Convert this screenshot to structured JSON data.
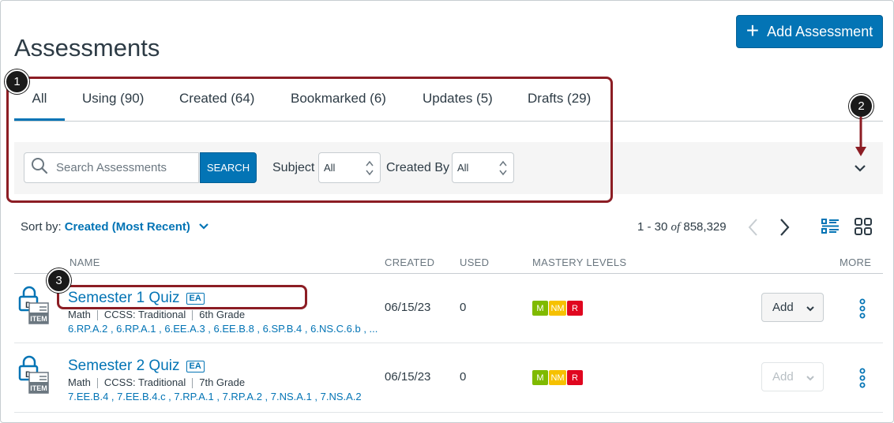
{
  "page": {
    "title": "Assessments",
    "add_button": "Add Assessment"
  },
  "tabs": [
    {
      "label": "All",
      "active": true
    },
    {
      "label": "Using (90)"
    },
    {
      "label": "Created (64)"
    },
    {
      "label": "Bookmarked (6)"
    },
    {
      "label": "Updates (5)"
    },
    {
      "label": "Drafts (29)"
    }
  ],
  "filters": {
    "search_placeholder": "Search Assessments",
    "search_button": "SEARCH",
    "subject_label": "Subject",
    "subject_value": "All",
    "created_by_label": "Created By",
    "created_by_value": "All"
  },
  "sort": {
    "label": "Sort by:",
    "value": "Created (Most Recent)"
  },
  "pagination": {
    "range": "1 - 30",
    "of": "of",
    "total": "858,329"
  },
  "columns": {
    "name": "NAME",
    "created": "CREATED",
    "used": "USED",
    "mastery": "MASTERY LEVELS",
    "more": "MORE"
  },
  "rows": [
    {
      "title": "Semester 1 Quiz",
      "badge": "EA",
      "subject": "Math",
      "framework": "CCSS: Traditional",
      "grade": "6th Grade",
      "standards": "6.RP.A.2 , 6.RP.A.1 , 6.EE.A.3 , 6.EE.B.8 , 6.SP.B.4 , 6.NS.C.6.b , ...",
      "created": "06/15/23",
      "used": "0",
      "mastery": [
        "M",
        "NM",
        "R"
      ],
      "add_label": "Add",
      "add_disabled": false
    },
    {
      "title": "Semester 2 Quiz",
      "badge": "EA",
      "subject": "Math",
      "framework": "CCSS: Traditional",
      "grade": "7th Grade",
      "standards": "7.EE.B.4 , 7.EE.B.4.c , 7.RP.A.1 , 7.RP.A.2 , 7.NS.A.1 , 7.NS.A.2",
      "created": "06/15/23",
      "used": "0",
      "mastery": [
        "M",
        "NM",
        "R"
      ],
      "add_label": "Add",
      "add_disabled": true
    }
  ],
  "icon_text": "ITEM",
  "callouts": [
    "1",
    "2",
    "3"
  ],
  "colors": {
    "accent": "#0374b5",
    "mastery_m": "#7fba00",
    "mastery_nm": "#f6c100",
    "mastery_r": "#e0061f",
    "callout_border": "#8c1d24"
  }
}
